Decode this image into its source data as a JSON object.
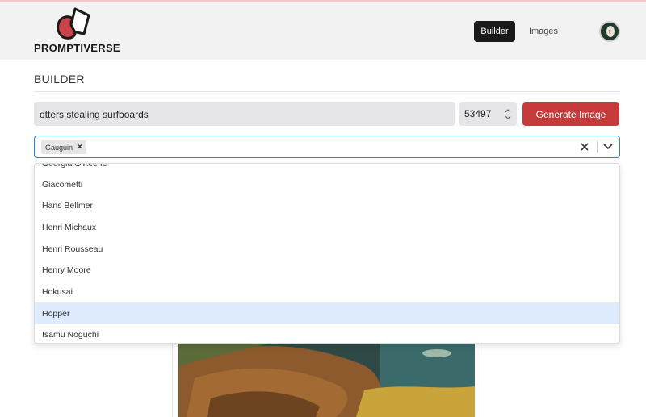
{
  "app": {
    "brand": "PROMPTIVERSE"
  },
  "nav": {
    "builder_label": "Builder",
    "images_label": "Images"
  },
  "avatar": {
    "initial": "t"
  },
  "builder": {
    "title": "BUILDER",
    "prompt_value": "otters stealing surfboards",
    "seed_value": "53497",
    "generate_label": "Generate Image"
  },
  "artist_select": {
    "selected": [
      {
        "label": "Gauguin",
        "remove_icon": "close-icon"
      }
    ],
    "options": [
      {
        "label": "Georgia O'Keeffe",
        "highlighted": false
      },
      {
        "label": "Giacometti",
        "highlighted": false
      },
      {
        "label": "Hans Bellmer",
        "highlighted": false
      },
      {
        "label": "Henri Michaux",
        "highlighted": false
      },
      {
        "label": "Henri Rousseau",
        "highlighted": false
      },
      {
        "label": "Henry Moore",
        "highlighted": false
      },
      {
        "label": "Hokusai",
        "highlighted": false
      },
      {
        "label": "Hopper",
        "highlighted": true
      },
      {
        "label": "Isamu Noguchi",
        "highlighted": false
      }
    ]
  },
  "colors": {
    "accent": "#c73a3b",
    "focus": "#2a7de1",
    "highlight": "#deebfd",
    "nav_active": "#1a1a1a"
  }
}
